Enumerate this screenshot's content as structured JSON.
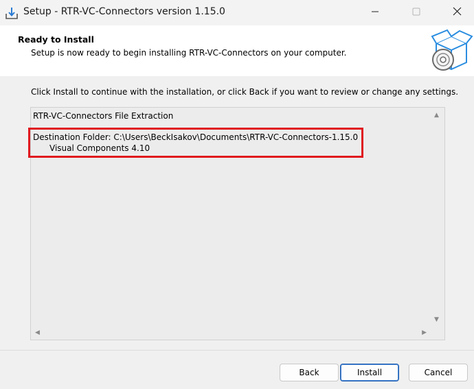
{
  "window": {
    "title": "Setup - RTR-VC-Connectors version 1.15.0",
    "minimize_icon": "minimize-icon",
    "maximize_icon": "maximize-icon",
    "close_icon": "close-icon"
  },
  "header": {
    "title": "Ready to Install",
    "subtitle": "Setup is now ready to begin installing RTR-VC-Connectors on your computer."
  },
  "main": {
    "instructions": "Click Install to continue with the installation, or click Back if you want to review or change any settings.",
    "memo": {
      "line1": "RTR-VC-Connectors File Extraction",
      "line2": "Destination Folder: C:\\Users\\BeckIsakov\\Documents\\RTR-VC-Connectors-1.15.0",
      "line3": "Visual Components 4.10"
    }
  },
  "footer": {
    "back_label": "Back",
    "install_label": "Install",
    "cancel_label": "Cancel"
  },
  "colors": {
    "highlight": "#e0191f",
    "install_border": "#1f5fb0"
  }
}
